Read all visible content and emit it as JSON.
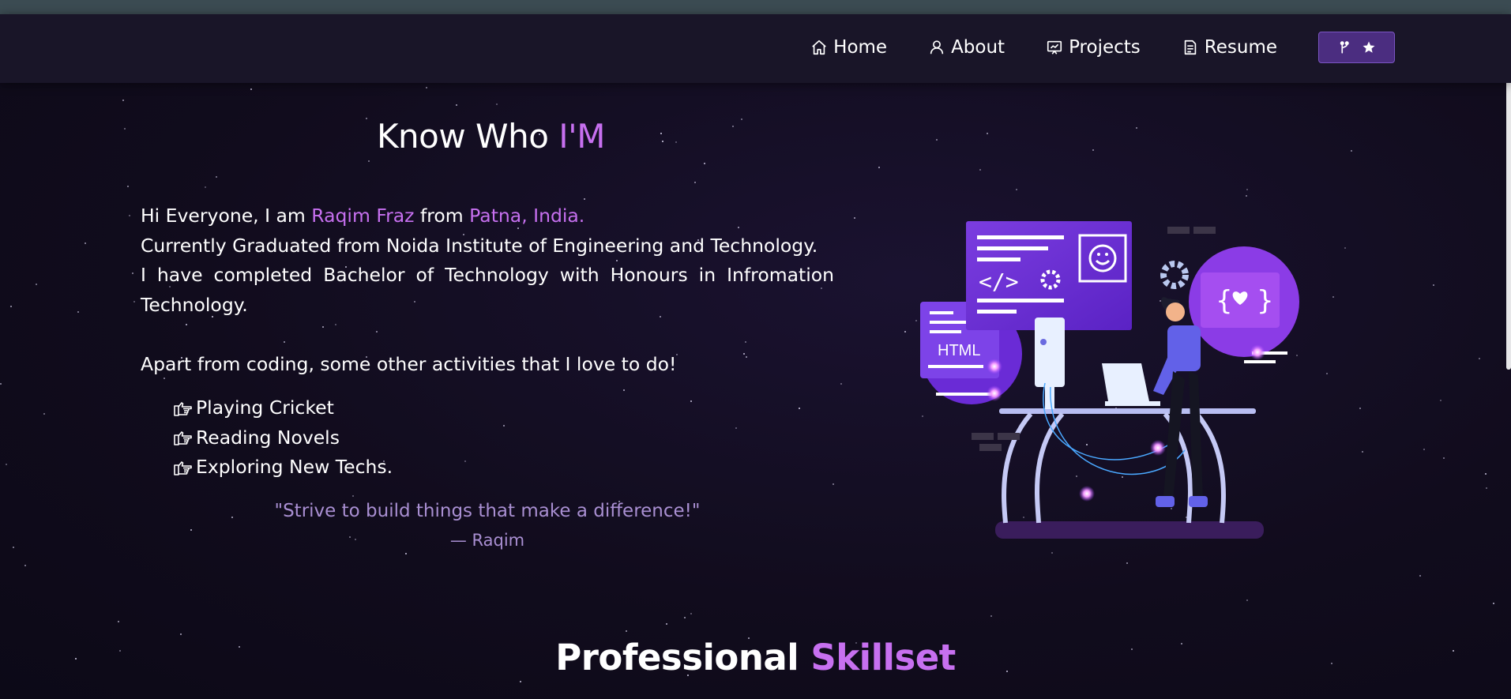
{
  "nav": {
    "items": [
      {
        "label": "Home",
        "icon": "home-icon"
      },
      {
        "label": "About",
        "icon": "user-icon"
      },
      {
        "label": "Projects",
        "icon": "projects-icon"
      },
      {
        "label": "Resume",
        "icon": "document-icon"
      }
    ],
    "github_button": {
      "icons": [
        "git-fork-icon",
        "star-icon"
      ]
    }
  },
  "about": {
    "heading_prefix": "Know Who ",
    "heading_accent": "I'M",
    "intro_prefix": "Hi Everyone, I am ",
    "name": "Raqim Fraz",
    "intro_middle": " from ",
    "location": "Patna, India.",
    "line2": "Currently Graduated from Noida Institute of Engineering and Technology.",
    "line3": "I have completed Bachelor of Technology with Honours in Infromation Technology.",
    "activities_intro": "Apart from coding, some other activities that I love to do!",
    "activities": [
      "Playing Cricket",
      "Reading Novels",
      "Exploring New Techs."
    ],
    "quote": "\"Strive to build things that make a difference!\"",
    "quote_author": "— Raqim"
  },
  "illustration": {
    "label": "HTML"
  },
  "skills": {
    "heading_prefix": "Professional ",
    "heading_accent": "Skillset"
  },
  "colors": {
    "accent": "#c770f0",
    "background": "#0f0b1a",
    "navbar": "#191528",
    "quote": "#a98fd2"
  }
}
